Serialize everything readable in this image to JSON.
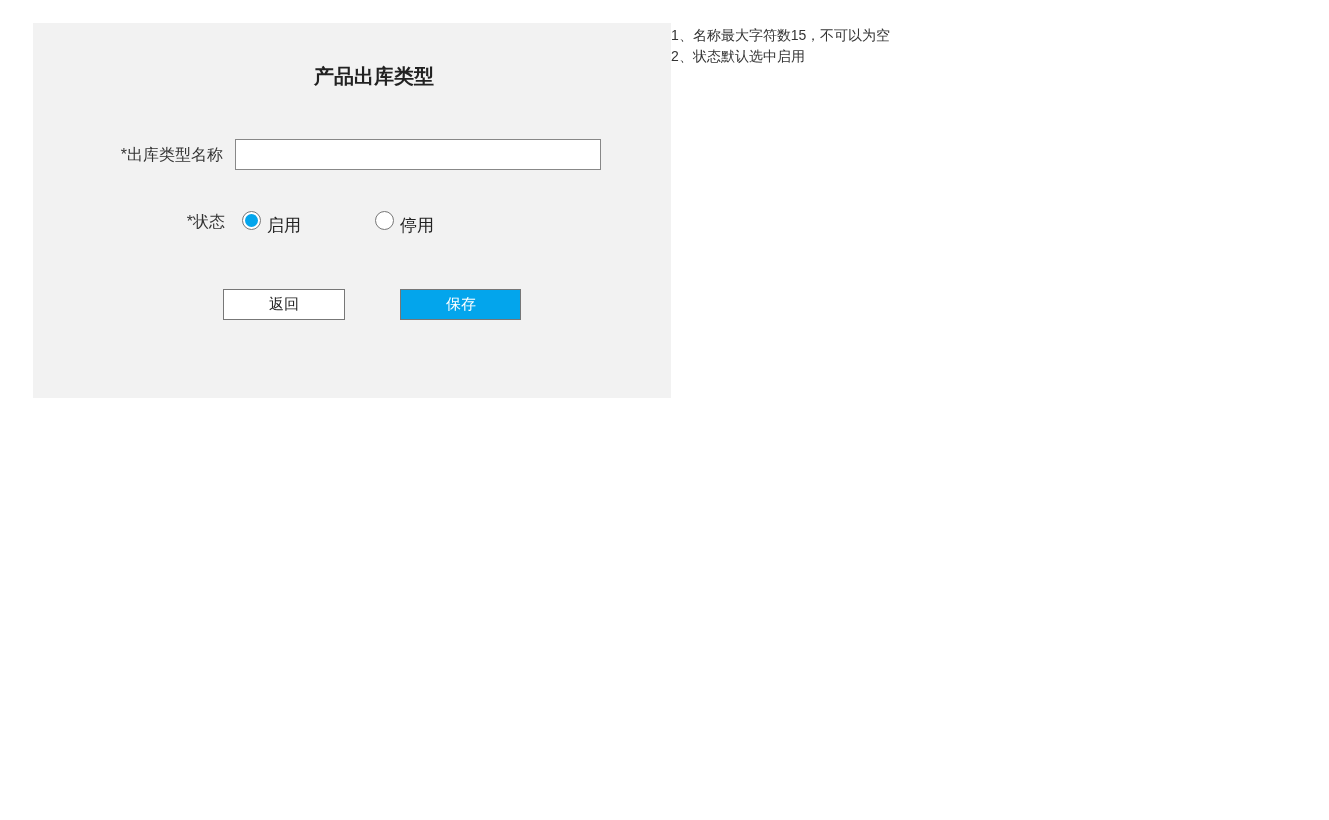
{
  "form": {
    "title": "产品出库类型",
    "name_field": {
      "label": "*出库类型名称"
    },
    "status": {
      "label": "*状态",
      "options": [
        {
          "label": "启用",
          "selected": true
        },
        {
          "label": "停用",
          "selected": false
        }
      ]
    },
    "buttons": [
      {
        "label": "返回",
        "kind": "secondary"
      },
      {
        "label": "保存",
        "kind": "primary"
      }
    ]
  },
  "notes": [
    "1、名称最大字符数15，不可以为空",
    "2、状态默认选中启用"
  ]
}
